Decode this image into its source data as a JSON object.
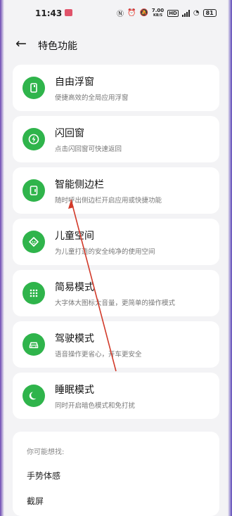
{
  "status_bar": {
    "time": "11:43",
    "speed_top": "7.00",
    "speed_bottom": "KB/S",
    "hd": "HD",
    "battery": "81"
  },
  "header": {
    "back_icon": "arrow-left-icon",
    "title": "特色功能"
  },
  "features": [
    {
      "title": "自由浮窗",
      "subtitle": "便捷高效的全局应用浮窗",
      "icon": "floating-window-icon"
    },
    {
      "title": "闪回窗",
      "subtitle": "点击闪回窗可快速返回",
      "icon": "flash-back-icon"
    },
    {
      "title": "智能侧边栏",
      "subtitle": "随时呼出侧边栏开启应用或快捷功能",
      "icon": "sidebar-icon"
    },
    {
      "title": "儿童空间",
      "subtitle": "为儿童打造的安全纯净的使用空间",
      "icon": "kids-space-icon"
    },
    {
      "title": "简易模式",
      "subtitle": "大字体大图标大音量，更简单的操作模式",
      "icon": "grid-icon"
    },
    {
      "title": "驾驶模式",
      "subtitle": "语音操作更省心，开车更安全",
      "icon": "car-icon"
    },
    {
      "title": "睡眠模式",
      "subtitle": "同时开启暗色模式和免打扰",
      "icon": "moon-icon"
    }
  ],
  "suggestions": {
    "heading": "你可能想找:",
    "items": [
      "手势体感",
      "截屏"
    ]
  },
  "colors": {
    "accent_green": "#2fb44b",
    "annotation_red": "#d23a2a"
  }
}
